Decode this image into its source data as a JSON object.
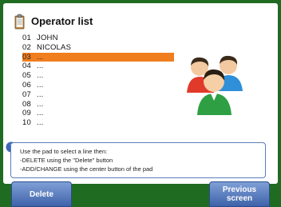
{
  "header": {
    "title": "Operator list",
    "icon": "clipboard-icon"
  },
  "operators": [
    {
      "num": "01",
      "name": "JOHN"
    },
    {
      "num": "02",
      "name": "NICOLAS"
    },
    {
      "num": "03",
      "name": "..."
    },
    {
      "num": "04",
      "name": "..."
    },
    {
      "num": "05",
      "name": "..."
    },
    {
      "num": "06",
      "name": "..."
    },
    {
      "num": "07",
      "name": "..."
    },
    {
      "num": "08",
      "name": "..."
    },
    {
      "num": "09",
      "name": "..."
    },
    {
      "num": "10",
      "name": "..."
    }
  ],
  "selected_index": 2,
  "illustration": "users-icon",
  "info": {
    "icon": "info-icon",
    "line1": "Use the pad to select a line then:",
    "line2": "-DELETE using the \"Delete\" button",
    "line3": "-ADD/CHANGE using the center button of the pad"
  },
  "buttons": {
    "delete": "Delete",
    "previous_line1": "Previous",
    "previous_line2": "screen"
  },
  "colors": {
    "selection": "#f07d1e",
    "button": "#4f72b8",
    "background": "#1f6b22"
  }
}
